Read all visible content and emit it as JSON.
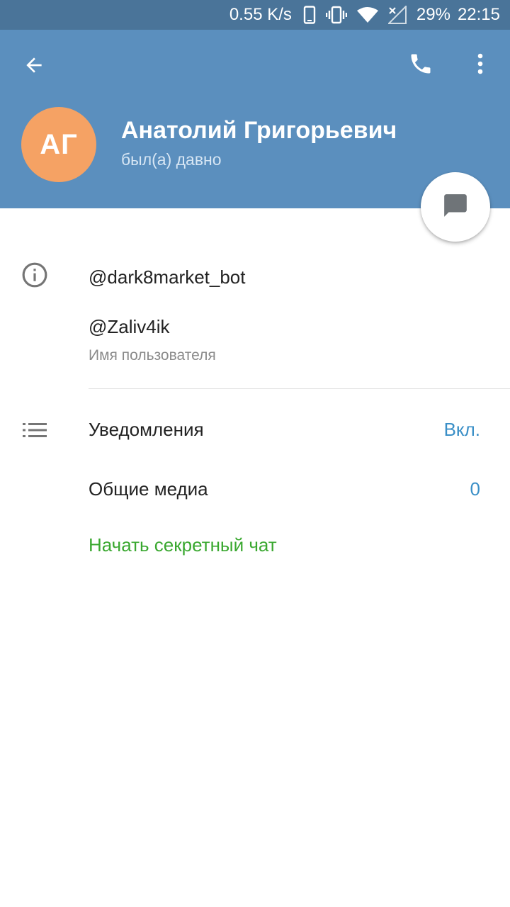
{
  "status_bar": {
    "speed": "0.55 K/s",
    "battery": "29%",
    "time": "22:15",
    "icons": [
      "phone-frame-icon",
      "vibrate-icon",
      "wifi-icon",
      "no-signal-icon"
    ]
  },
  "header": {
    "icons": [
      "back-arrow-icon",
      "phone-call-icon",
      "more-vert-icon"
    ],
    "avatar_initials": "АГ",
    "name": "Анатолий Григорьевич",
    "status": "был(а) давно",
    "colors": {
      "header": "#5b8fbe",
      "status_bar": "#4a7499",
      "avatar": "#f5a264"
    }
  },
  "fab": {
    "icon": "message-icon"
  },
  "info": {
    "icon": "info-icon",
    "bio": "@dark8market_bot",
    "username": "@Zaliv4ik",
    "username_label": "Имя пользователя"
  },
  "settings": {
    "icon": "list-icon",
    "notifications_label": "Уведомления",
    "notifications_value": "Вкл.",
    "media_label": "Общие медиа",
    "media_value": "0",
    "secret_chat_label": "Начать секретный чат",
    "colors": {
      "value": "#3a8fc7",
      "secret_chat": "#3aa830"
    }
  }
}
